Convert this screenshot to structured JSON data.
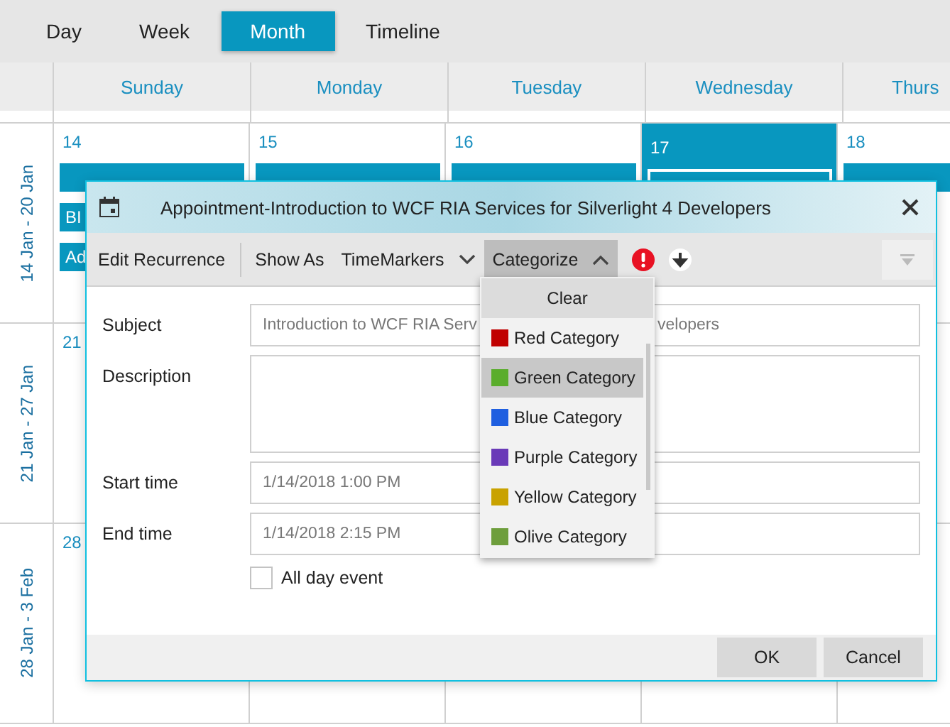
{
  "view_tabs": [
    {
      "label": "Day",
      "selected": false
    },
    {
      "label": "Week",
      "selected": false
    },
    {
      "label": "Month",
      "selected": true
    },
    {
      "label": "Timeline",
      "selected": false
    }
  ],
  "day_headers": [
    "Sunday",
    "Monday",
    "Tuesday",
    "Wednesday",
    "Thurs"
  ],
  "weeks": [
    {
      "label": "14 Jan - 20 Jan",
      "days": [
        {
          "date": "14",
          "today": false,
          "appointments": [
            {
              "selected": false
            },
            {
              "label": "BI",
              "selected": false
            },
            {
              "label": "Ad",
              "selected": false
            }
          ]
        },
        {
          "date": "15",
          "today": false,
          "appointments": [
            {
              "selected": false
            }
          ]
        },
        {
          "date": "16",
          "today": false,
          "appointments": [
            {
              "selected": false
            }
          ]
        },
        {
          "date": "17",
          "today": true,
          "appointments": [
            {
              "selected": true
            }
          ]
        },
        {
          "date": "18",
          "today": false,
          "appointments": [
            {
              "selected": false
            }
          ]
        }
      ]
    },
    {
      "label": "21 Jan - 27 Jan",
      "days": [
        {
          "date": "21",
          "today": false
        }
      ]
    },
    {
      "label": "28 Jan - 3 Feb",
      "days": [
        {
          "date": "28",
          "today": false
        }
      ]
    }
  ],
  "dialog": {
    "title": "Appointment-Introduction to WCF RIA Services for Silverlight 4 Developers",
    "toolbar": [
      {
        "kind": "button",
        "label": "Edit Recurrence",
        "pressed": false
      },
      {
        "kind": "separator"
      },
      {
        "kind": "button",
        "label": "Show As",
        "pressed": false
      },
      {
        "kind": "dropdown",
        "label": "TimeMarkers",
        "pressed": false
      },
      {
        "kind": "dropdown",
        "label": "Categorize",
        "pressed": true
      },
      {
        "kind": "high-importance"
      },
      {
        "kind": "low-importance"
      }
    ],
    "fields": [
      {
        "kind": "covered",
        "label": "Subject",
        "value_parts": [
          "Introduction to WCF RIA Serv",
          "velopers"
        ]
      },
      {
        "kind": "multiline",
        "label": "Description"
      },
      {
        "kind": "text",
        "label": "Start time",
        "value": "1/14/2018 1:00 PM"
      },
      {
        "kind": "text",
        "label": "End time",
        "value": "1/14/2018 2:15 PM"
      }
    ],
    "all_day": {
      "label": "All day event",
      "checked": false
    },
    "buttons": [
      "OK",
      "Cancel"
    ],
    "category_menu": {
      "clear": "Clear",
      "items": [
        {
          "label": "Red Category",
          "color": "#c00000",
          "selected": false
        },
        {
          "label": "Green Category",
          "color": "#5aad2c",
          "selected": true
        },
        {
          "label": "Blue Category",
          "color": "#1f5fe0",
          "selected": false
        },
        {
          "label": "Purple Category",
          "color": "#6a3ab8",
          "selected": false
        },
        {
          "label": "Yellow Category",
          "color": "#c9a200",
          "selected": false
        },
        {
          "label": "Olive Category",
          "color": "#6e9e3c",
          "selected": false
        }
      ]
    }
  }
}
